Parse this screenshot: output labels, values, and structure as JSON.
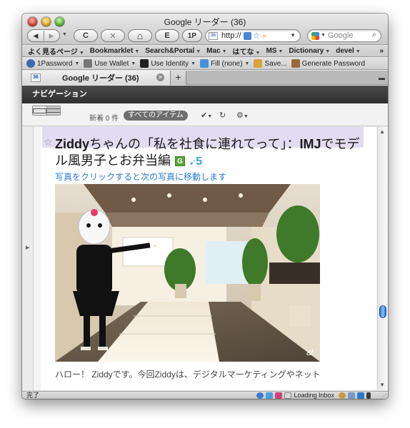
{
  "window": {
    "title": "Google リーダー (36)"
  },
  "toolbar": {
    "back_icon": "◀",
    "forward_icon": "▶",
    "reload_icon": "C",
    "stop_icon": "✕",
    "home_icon": "⌂",
    "evernote_icon": "E",
    "onepassword_label": "1P",
    "url_text": "http://",
    "search_placeholder": "Google"
  },
  "bookmarks": [
    {
      "label": "よく見るページ",
      "dropdown": true
    },
    {
      "label": "Bookmarklet",
      "dropdown": true
    },
    {
      "label": "Search&Portal",
      "dropdown": true
    },
    {
      "label": "Mac",
      "dropdown": true
    },
    {
      "label": "はてな",
      "dropdown": true
    },
    {
      "label": "MS",
      "dropdown": true
    },
    {
      "label": "Dictionary",
      "dropdown": true
    },
    {
      "label": "devel",
      "dropdown": true
    }
  ],
  "bookmarks_overflow": "»",
  "addons": [
    {
      "label": "1Password",
      "icon": "key-icon",
      "color": "#3a6bb0",
      "dropdown": true
    },
    {
      "label": "Use Wallet",
      "icon": "wallet-icon",
      "color": "#777777",
      "dropdown": true
    },
    {
      "label": "Use Identity",
      "icon": "identity-icon",
      "color": "#222222",
      "dropdown": true
    },
    {
      "label": "Fill (none)",
      "icon": "fill-icon",
      "color": "#4a90d9",
      "dropdown": true
    },
    {
      "label": "Save...",
      "icon": "save-icon",
      "color": "#d9a23a",
      "dropdown": false
    },
    {
      "label": "Generate Password",
      "icon": "generate-icon",
      "color": "#9a6a3a",
      "dropdown": false
    }
  ],
  "tab": {
    "label": "Google リーダー (36)",
    "favicon_text": "36",
    "new_tab": "+"
  },
  "reader": {
    "nav_label": "ナビゲーション",
    "new_count": "新着 0 件",
    "all_items": "すべてのアイテム",
    "check_icon": "✔",
    "refresh_icon": "↻",
    "settings_icon": "⚙"
  },
  "article": {
    "title_prefix": "Ziddy",
    "title_rest": "ちゃんの「私を社食に連れてって」：",
    "title_bold_mid": "IMJ",
    "title_tail": "でモデル風男子とお弁当編",
    "g_badge": "G",
    "tweet_count": "5",
    "subtitle": "写真をクリックすると次の写真に移動します",
    "excerpt": "ハロー！ Ziddyです。今回Ziddyは、デジタルマーケティングやネット",
    "photo_watermark": "al"
  },
  "status": {
    "left": "完了",
    "loading": "Loading Inbox"
  },
  "colors": {
    "headline_band": "#e2dcf2",
    "link_blue": "#2a7cd0",
    "nav_dark": "#3a3a3a"
  }
}
